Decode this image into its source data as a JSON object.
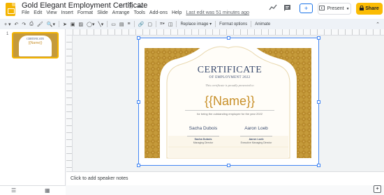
{
  "app": {
    "doc_title": "Gold Elegant Employment Certificate",
    "icons": {
      "star": "☆",
      "move": "⎘",
      "cloud": "☁"
    }
  },
  "menu": {
    "items": [
      "File",
      "Edit",
      "View",
      "Insert",
      "Format",
      "Slide",
      "Arrange",
      "Tools",
      "Add-ons",
      "Help"
    ],
    "last_edit": "Last edit was 51 minutes ago"
  },
  "header": {
    "present_label": "Present",
    "share_label": "Share",
    "add_label": "+"
  },
  "toolbar": {
    "replace_image": "Replace image",
    "format_options": "Format options",
    "animate": "Animate"
  },
  "filmstrip": {
    "slide_number": "1",
    "thumb_title": "CERTIFICATE",
    "thumb_name": "{{Name}}"
  },
  "certificate": {
    "title": "CERTIFICATE",
    "subtitle": "OF EMPLOYMENT 2022",
    "presented": "This certificate is proudly presented to",
    "name": "{{Name}}",
    "reason": "for being the outstanding employee for the year 2022",
    "signers": [
      {
        "signature": "Sacha Dubois",
        "name": "Sacha Dubois",
        "role": "Managing Director"
      },
      {
        "signature": "Aaron Loeb",
        "name": "Aaron Loeb",
        "role": "Executive Managing Director"
      }
    ]
  },
  "notes": {
    "placeholder": "Click to add speaker notes"
  },
  "colors": {
    "gold": "#c8902a",
    "navy": "#3b4c6e",
    "share": "#fbbc04",
    "selection": "#4285f4"
  }
}
